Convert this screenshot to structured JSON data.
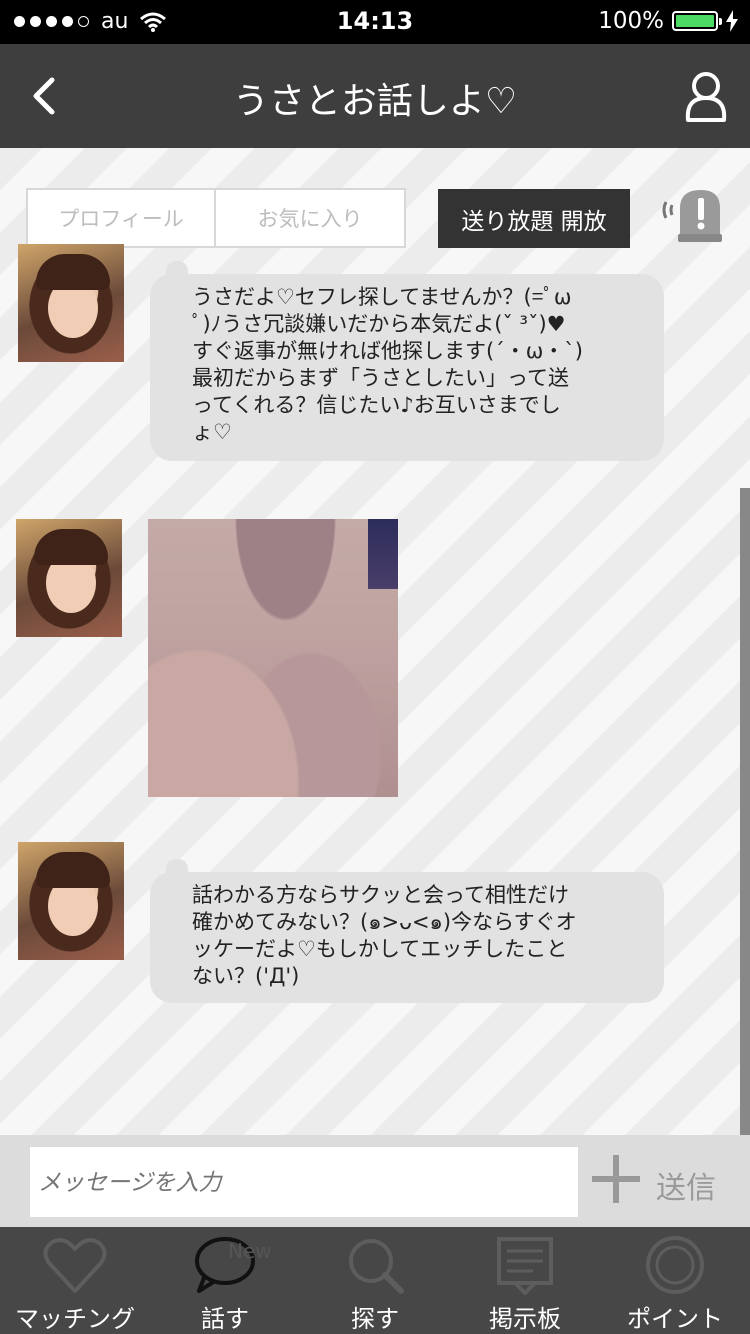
{
  "status_bar": {
    "carrier": "au",
    "time": "14:13",
    "battery_text": "100%",
    "battery_level": 1.0,
    "signal_dots_filled": 4,
    "signal_dots_total": 5
  },
  "navbar": {
    "title": "うさとお話しよ♡",
    "back_icon": "chevron-left-icon",
    "profile_icon": "person-icon"
  },
  "chat_tabs": {
    "profile_label": "プロフィール",
    "favorite_label": "お気に入り",
    "unlimited_label": "送り放題 開放",
    "alert_icon": "alert-icon"
  },
  "messages": [
    {
      "type": "text",
      "lines": [
        "うさだよ♡セフレ探してませんか？(=ﾟω",
        "ﾟ)ﾉうさ冗談嫌いだから本気だよ(ˇ ³ˇ)♥",
        "すぐ返事が無ければ他探します(´・ω・`)",
        "最初だからまず「うさとしたい」って送",
        "ってくれる？信じたい♪お互いさまでし",
        "ょ♡"
      ]
    },
    {
      "type": "image"
    },
    {
      "type": "text",
      "lines": [
        "話わかる方ならサクッと会って相性だけ",
        "確かめてみない？(๑>ᴗ<๑)今ならすぐオ",
        "ッケーだよ♡もしかしてエッチしたこと",
        "ない？('Д')"
      ]
    }
  ],
  "input": {
    "placeholder": "メッセージを入力",
    "send_label": "送信",
    "plus_icon": "plus-icon"
  },
  "tabbar": {
    "items": [
      {
        "label": "マッチング",
        "icon": "heart-icon"
      },
      {
        "label": "話す",
        "icon": "speech-bubble-icon"
      },
      {
        "label": "探す",
        "icon": "search-icon"
      },
      {
        "label": "掲示板",
        "icon": "board-icon"
      },
      {
        "label": "ポイント",
        "icon": "coin-icon"
      }
    ],
    "new_badge": "New"
  },
  "colors": {
    "navbar": "#3e3e3e",
    "tabbar": "#474747",
    "bubble": "#e2e2e2",
    "battery": "#4cd964"
  }
}
